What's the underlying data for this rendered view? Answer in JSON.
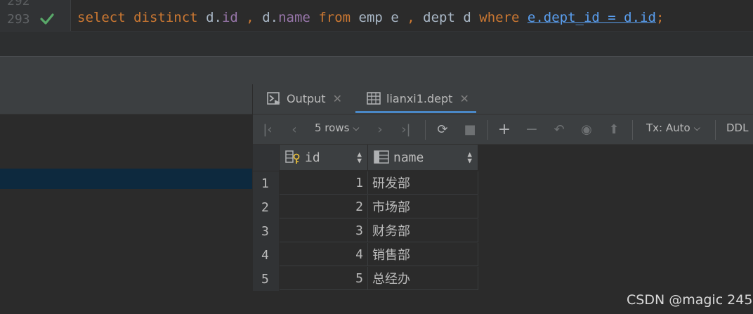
{
  "editor": {
    "prev_line_number": "292",
    "line_number": "293",
    "code": {
      "select": "select",
      "distinct": "distinct",
      "d1": "d.",
      "id1": "id",
      "comma1": ",",
      "d2": "d.",
      "name": "name",
      "from": "from",
      "emp": "emp",
      "e": "e",
      "comma2": ",",
      "dept": "dept",
      "d3": "d",
      "where": "where",
      "condition": "e.dept_id = d.id",
      "semicolon": ";"
    }
  },
  "tabs": [
    {
      "label": "Output",
      "icon": "console-icon"
    },
    {
      "label": "lianxi1.dept",
      "icon": "table-icon",
      "active": true
    }
  ],
  "toolbar": {
    "rows_label": "5 rows",
    "tx_label": "Tx: Auto",
    "ddl_label": "DDL"
  },
  "grid": {
    "columns": [
      {
        "name": "id",
        "icon": "primary-key-column-icon"
      },
      {
        "name": "name",
        "icon": "column-icon"
      }
    ],
    "rows": [
      {
        "num": "1",
        "id": "1",
        "name": "研发部"
      },
      {
        "num": "2",
        "id": "2",
        "name": "市场部"
      },
      {
        "num": "3",
        "id": "3",
        "name": "财务部"
      },
      {
        "num": "4",
        "id": "4",
        "name": "销售部"
      },
      {
        "num": "5",
        "id": "5",
        "name": "总经办"
      }
    ]
  },
  "watermark": "CSDN @magic 245",
  "colors": {
    "keyword": "#cc7832",
    "field": "#9876aa",
    "link": "#5a9ff0",
    "check": "#59a869",
    "selection": "#0d293e",
    "tab_underline": "#4a88c7"
  }
}
